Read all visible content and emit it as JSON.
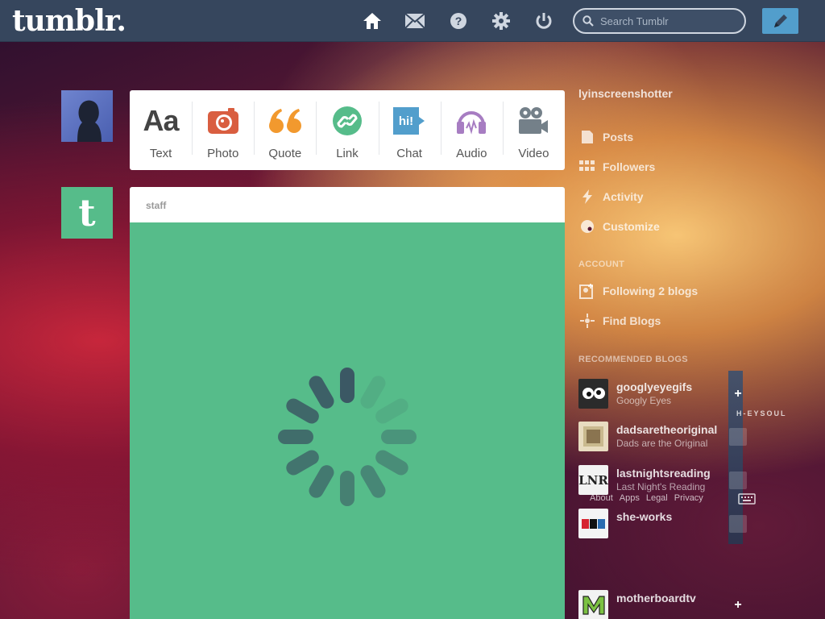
{
  "header": {
    "logo": "tumblr.",
    "search_placeholder": "Search Tumblr",
    "nav": [
      {
        "icon": "home-icon"
      },
      {
        "icon": "mail-icon"
      },
      {
        "icon": "help-icon"
      },
      {
        "icon": "gear-icon"
      },
      {
        "icon": "power-icon"
      }
    ],
    "compose_icon": "pencil-icon"
  },
  "post_types": [
    {
      "label": "Text",
      "glyph": "Aa",
      "color": "#444444"
    },
    {
      "label": "Photo",
      "color": "#d95e40"
    },
    {
      "label": "Quote",
      "glyph": "66",
      "color": "#f2992e"
    },
    {
      "label": "Link",
      "color": "#56bc8a"
    },
    {
      "label": "Chat",
      "glyph": "hi!",
      "color": "#529ecc"
    },
    {
      "label": "Audio",
      "color": "#a77dc2"
    },
    {
      "label": "Video",
      "color": "#748089"
    }
  ],
  "post": {
    "author": "staff",
    "background": "#56bc8a",
    "state": "loading"
  },
  "sidebar": {
    "blog_name": "lyinscreenshotter",
    "blog_links": [
      {
        "label": "Posts",
        "icon": "document-icon"
      },
      {
        "label": "Followers",
        "icon": "followers-icon"
      },
      {
        "label": "Activity",
        "icon": "activity-icon"
      },
      {
        "label": "Customize",
        "icon": "palette-icon"
      }
    ],
    "account_heading": "ACCOUNT",
    "account_links": [
      {
        "label": "Following 2 blogs",
        "icon": "following-icon"
      },
      {
        "label": "Find Blogs",
        "icon": "compass-icon"
      }
    ],
    "recommended_heading": "RECOMMENDED BLOGS",
    "recommended": [
      {
        "name": "googlyeyegifs",
        "desc": "Googly Eyes"
      },
      {
        "name": "dadsaretheoriginal",
        "desc": "Dads are the Original"
      },
      {
        "name": "lastnightsreading",
        "desc": "Last Night's Reading"
      },
      {
        "name": "she-works",
        "desc": ""
      },
      {
        "name": "motherboardtv",
        "desc": ""
      }
    ],
    "overlay_text": "H-EYSOUL",
    "footer": [
      "About",
      "Apps",
      "Legal",
      "Privacy"
    ]
  }
}
